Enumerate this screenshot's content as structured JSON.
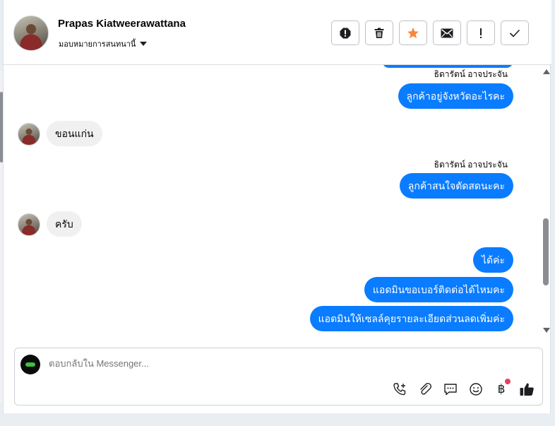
{
  "header": {
    "contact_name": "Prapas Kiatweerawattana",
    "assign_label": "มอบหมายการสนทนานี้",
    "actions": [
      {
        "name": "spam-icon"
      },
      {
        "name": "trash-icon"
      },
      {
        "name": "star-icon"
      },
      {
        "name": "envelope-icon"
      },
      {
        "name": "exclamation-icon"
      },
      {
        "name": "check-icon"
      }
    ]
  },
  "thread": {
    "sender_name_1": "ธิดารัตน์ อาจประจัน",
    "msg_1": "ลูกค้าอยู่จังหวัดอะไรคะ",
    "reply_1": "ขอนแก่น",
    "sender_name_2": "ธิดารัตน์ อาจประจัน",
    "msg_2": "ลูกค้าสนใจตัดสดนะคะ",
    "reply_2": "ครับ",
    "msg_3": "ได้ค่ะ",
    "msg_4": "แอดมินขอเบอร์ติดต่อได้ไหมคะ",
    "msg_5": "แอดมินให้เซลล์คุยรายละเอียดส่วนลดเพิ่มค่ะ"
  },
  "composer": {
    "placeholder": "ตอบกลับใน Messenger...",
    "tools": [
      "phone-plus-icon",
      "paperclip-icon",
      "chat-bubble-icon",
      "smile-icon",
      "baht-icon",
      "thumbs-up-icon"
    ],
    "baht_symbol": "฿"
  },
  "colors": {
    "bubble_out": "#0a7cff",
    "bubble_in": "#f0f0f0",
    "star": "#f5883a",
    "notification_dot": "#e4405f"
  }
}
